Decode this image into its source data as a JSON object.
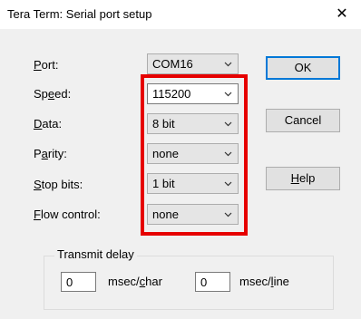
{
  "window": {
    "title": "Tera Term: Serial port setup",
    "close_glyph": "✕"
  },
  "fields": [
    {
      "label_key": "P",
      "label_rest": "ort:",
      "value": "COM16"
    },
    {
      "label_pre": "Sp",
      "label_key": "e",
      "label_rest": "ed:",
      "value": "115200"
    },
    {
      "label_key": "D",
      "label_rest": "ata:",
      "value": "8 bit"
    },
    {
      "label_pre": "P",
      "label_key": "a",
      "label_rest": "rity:",
      "value": "none"
    },
    {
      "label_key": "S",
      "label_rest": "top bits:",
      "value": "1 bit"
    },
    {
      "label_key": "F",
      "label_rest": "low control:",
      "value": "none"
    }
  ],
  "buttons": {
    "ok": "OK",
    "cancel": "Cancel",
    "help_key": "H",
    "help_rest": "elp"
  },
  "transmit_delay": {
    "title": "Transmit delay",
    "char_value": "0",
    "char_unit_pre": "msec/",
    "char_unit_key": "c",
    "char_unit_rest": "har",
    "line_value": "0",
    "line_unit_pre": "msec/",
    "line_unit_key": "l",
    "line_unit_rest": "ine"
  },
  "colors": {
    "highlight": "#e60000",
    "default_button_border": "#0078d7"
  }
}
